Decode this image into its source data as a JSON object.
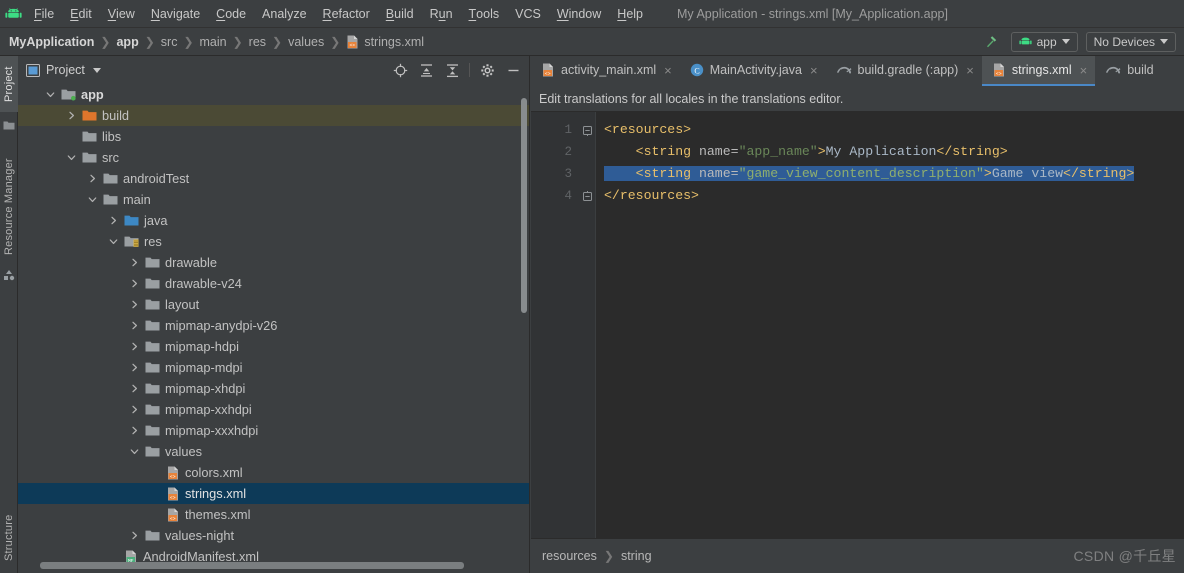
{
  "window": {
    "title": "My Application - strings.xml [My_Application.app]",
    "logo_icon": "android-logo-icon"
  },
  "menubar": {
    "items": [
      {
        "label": "File",
        "mnemonic": "F"
      },
      {
        "label": "Edit",
        "mnemonic": "E"
      },
      {
        "label": "View",
        "mnemonic": "V"
      },
      {
        "label": "Navigate",
        "mnemonic": "N"
      },
      {
        "label": "Code",
        "mnemonic": "C"
      },
      {
        "label": "Analyze",
        "mnemonic": ""
      },
      {
        "label": "Refactor",
        "mnemonic": "R"
      },
      {
        "label": "Build",
        "mnemonic": "B"
      },
      {
        "label": "Run",
        "mnemonic": "u"
      },
      {
        "label": "Tools",
        "mnemonic": "T"
      },
      {
        "label": "VCS",
        "mnemonic": ""
      },
      {
        "label": "Window",
        "mnemonic": "W"
      },
      {
        "label": "Help",
        "mnemonic": "H"
      }
    ]
  },
  "navbar": {
    "crumbs": [
      {
        "label": "MyApplication",
        "bold": true,
        "icon": ""
      },
      {
        "label": "app",
        "bold": true,
        "icon": ""
      },
      {
        "label": "src",
        "bold": false,
        "icon": ""
      },
      {
        "label": "main",
        "bold": false,
        "icon": ""
      },
      {
        "label": "res",
        "bold": false,
        "icon": ""
      },
      {
        "label": "values",
        "bold": false,
        "icon": ""
      },
      {
        "label": "strings.xml",
        "bold": false,
        "icon": "xml-file-icon"
      }
    ],
    "hammer_icon": "build-hammer-icon",
    "run_config": "app",
    "run_config_icon": "android-logo-icon",
    "device_selector": "No Devices"
  },
  "toolstrip": {
    "tabs": [
      {
        "label": "Project",
        "active": true
      },
      {
        "label": "Resource Manager",
        "active": false
      },
      {
        "label": "Structure",
        "active": false
      }
    ]
  },
  "project_panel": {
    "title": "Project",
    "title_icon": "project-view-icon",
    "dropdown_icon": "chevron-down-icon",
    "tools": [
      {
        "name": "locate-icon"
      },
      {
        "name": "expand-all-icon"
      },
      {
        "name": "collapse-all-icon"
      },
      {
        "name": "gear-icon"
      },
      {
        "name": "minimize-icon"
      }
    ],
    "tree": [
      {
        "label": "app",
        "depth": 0,
        "arrow": "down",
        "icon": "module-folder-icon",
        "bold": true,
        "state": "none"
      },
      {
        "label": "build",
        "depth": 1,
        "arrow": "right",
        "icon": "build-folder-icon",
        "bold": false,
        "state": "highlight"
      },
      {
        "label": "libs",
        "depth": 1,
        "arrow": "none",
        "icon": "folder-icon",
        "bold": false,
        "state": "none"
      },
      {
        "label": "src",
        "depth": 1,
        "arrow": "down",
        "icon": "folder-icon",
        "bold": false,
        "state": "none"
      },
      {
        "label": "androidTest",
        "depth": 2,
        "arrow": "right",
        "icon": "folder-icon",
        "bold": false,
        "state": "none"
      },
      {
        "label": "main",
        "depth": 2,
        "arrow": "down",
        "icon": "folder-icon",
        "bold": false,
        "state": "none"
      },
      {
        "label": "java",
        "depth": 3,
        "arrow": "right",
        "icon": "source-folder-icon",
        "bold": false,
        "state": "none"
      },
      {
        "label": "res",
        "depth": 3,
        "arrow": "down",
        "icon": "res-folder-icon",
        "bold": false,
        "state": "none"
      },
      {
        "label": "drawable",
        "depth": 4,
        "arrow": "right",
        "icon": "folder-icon",
        "bold": false,
        "state": "none"
      },
      {
        "label": "drawable-v24",
        "depth": 4,
        "arrow": "right",
        "icon": "folder-icon",
        "bold": false,
        "state": "none"
      },
      {
        "label": "layout",
        "depth": 4,
        "arrow": "right",
        "icon": "folder-icon",
        "bold": false,
        "state": "none"
      },
      {
        "label": "mipmap-anydpi-v26",
        "depth": 4,
        "arrow": "right",
        "icon": "folder-icon",
        "bold": false,
        "state": "none"
      },
      {
        "label": "mipmap-hdpi",
        "depth": 4,
        "arrow": "right",
        "icon": "folder-icon",
        "bold": false,
        "state": "none"
      },
      {
        "label": "mipmap-mdpi",
        "depth": 4,
        "arrow": "right",
        "icon": "folder-icon",
        "bold": false,
        "state": "none"
      },
      {
        "label": "mipmap-xhdpi",
        "depth": 4,
        "arrow": "right",
        "icon": "folder-icon",
        "bold": false,
        "state": "none"
      },
      {
        "label": "mipmap-xxhdpi",
        "depth": 4,
        "arrow": "right",
        "icon": "folder-icon",
        "bold": false,
        "state": "none"
      },
      {
        "label": "mipmap-xxxhdpi",
        "depth": 4,
        "arrow": "right",
        "icon": "folder-icon",
        "bold": false,
        "state": "none"
      },
      {
        "label": "values",
        "depth": 4,
        "arrow": "down",
        "icon": "folder-icon",
        "bold": false,
        "state": "none"
      },
      {
        "label": "colors.xml",
        "depth": 5,
        "arrow": "none",
        "icon": "xml-file-icon",
        "bold": false,
        "state": "none"
      },
      {
        "label": "strings.xml",
        "depth": 5,
        "arrow": "none",
        "icon": "xml-file-icon",
        "bold": false,
        "state": "selected"
      },
      {
        "label": "themes.xml",
        "depth": 5,
        "arrow": "none",
        "icon": "xml-file-icon",
        "bold": false,
        "state": "none"
      },
      {
        "label": "values-night",
        "depth": 4,
        "arrow": "right",
        "icon": "folder-icon",
        "bold": false,
        "state": "none"
      },
      {
        "label": "AndroidManifest.xml",
        "depth": 3,
        "arrow": "none",
        "icon": "manifest-file-icon",
        "bold": false,
        "state": "none"
      }
    ]
  },
  "editor": {
    "tabs": [
      {
        "label": "activity_main.xml",
        "icon": "xml-file-icon",
        "active": false,
        "close": "×"
      },
      {
        "label": "MainActivity.java",
        "icon": "java-class-icon",
        "active": false,
        "close": "×"
      },
      {
        "label": "build.gradle (:app)",
        "icon": "gradle-file-icon",
        "active": false,
        "close": "×"
      },
      {
        "label": "strings.xml",
        "icon": "xml-file-icon",
        "active": true,
        "close": "×"
      },
      {
        "label": "build",
        "icon": "gradle-file-icon",
        "active": false,
        "close": ""
      }
    ],
    "banner": "Edit translations for all locales in the translations editor.",
    "line_numbers": [
      "1",
      "2",
      "3",
      "4"
    ],
    "lightbulb_line": 3,
    "lightbulb_icon": "intention-bulb-icon",
    "lines": [
      {
        "n": 1,
        "indent": 0,
        "selected": false,
        "tokens": [
          {
            "t": "tag",
            "v": "<resources>"
          }
        ]
      },
      {
        "n": 2,
        "indent": 4,
        "selected": false,
        "tokens": [
          {
            "t": "tag",
            "v": "<string"
          },
          {
            "t": "plain",
            "v": " "
          },
          {
            "t": "attr",
            "v": "name="
          },
          {
            "t": "str",
            "v": "\"app_name\""
          },
          {
            "t": "tag",
            "v": ">"
          },
          {
            "t": "text",
            "v": "My Application"
          },
          {
            "t": "tag",
            "v": "</string>"
          }
        ]
      },
      {
        "n": 3,
        "indent": 4,
        "selected": true,
        "tokens": [
          {
            "t": "tag",
            "v": "<string"
          },
          {
            "t": "plain",
            "v": " "
          },
          {
            "t": "attr",
            "v": "name="
          },
          {
            "t": "str",
            "v": "\"game_view_content_description\""
          },
          {
            "t": "tag",
            "v": ">"
          },
          {
            "t": "text",
            "v": "Game view"
          },
          {
            "t": "tag",
            "v": "</string>"
          }
        ]
      },
      {
        "n": 4,
        "indent": 0,
        "selected": false,
        "tokens": [
          {
            "t": "tag",
            "v": "</resources>"
          }
        ]
      }
    ],
    "status_breadcrumb": [
      "resources",
      "string"
    ],
    "watermark": "CSDN @千丘星"
  },
  "colors": {
    "panel_bg": "#3c3f41",
    "editor_bg": "#2b2b2b",
    "gutter_bg": "#313335",
    "selection_blue": "#2f5c96",
    "tree_selected": "#0d3a58",
    "tab_accent": "#4a88c7",
    "build_highlight": "#4b4a35",
    "android_green": "#3ddc84",
    "xml_orange": "#e8833a",
    "tag_color": "#e8bf6a",
    "string_color": "#6a8759",
    "text_color": "#a9b7c6"
  }
}
